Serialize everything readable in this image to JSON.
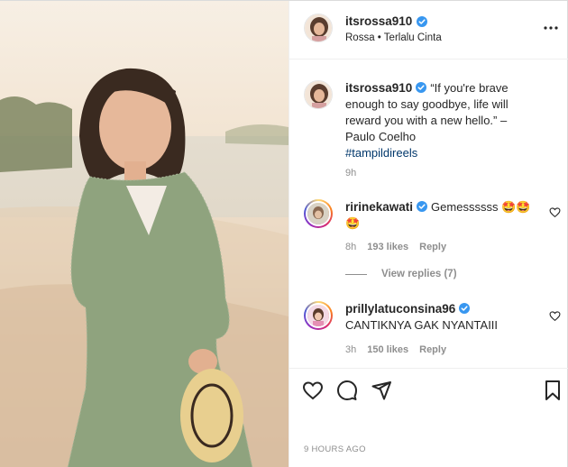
{
  "post": {
    "username": "itsrossa910",
    "subtitle": "Rossa • Terlalu Cinta",
    "caption": {
      "username": "itsrossa910",
      "text": "“If you're brave enough to say goodbye, life will reward you with a new hello.” – Paulo Coelho",
      "hashtag": "#tampildireels",
      "age": "9h"
    },
    "timestamp": "9 HOURS AGO"
  },
  "comments": [
    {
      "username": "ririnekawati",
      "text": "Gemessssss 🤩🤩🤩",
      "age": "8h",
      "likes": "193 likes",
      "reply": "Reply",
      "view_replies": "View replies (7)"
    },
    {
      "username": "prillylatuconsina96",
      "text": "CANTIKNYA GAK NYANTAIII",
      "age": "3h",
      "likes": "150 likes",
      "reply": "Reply"
    }
  ],
  "icons": {
    "more": "more-options-icon",
    "like": "heart-icon",
    "comment": "comment-bubble-icon",
    "share": "paper-plane-icon",
    "save": "bookmark-icon",
    "verified": "verified-badge-icon"
  },
  "colors": {
    "verified": "#3897f0",
    "hashtag": "#00376b",
    "muted": "#8e8e8e",
    "dress": "#8fa37e"
  }
}
